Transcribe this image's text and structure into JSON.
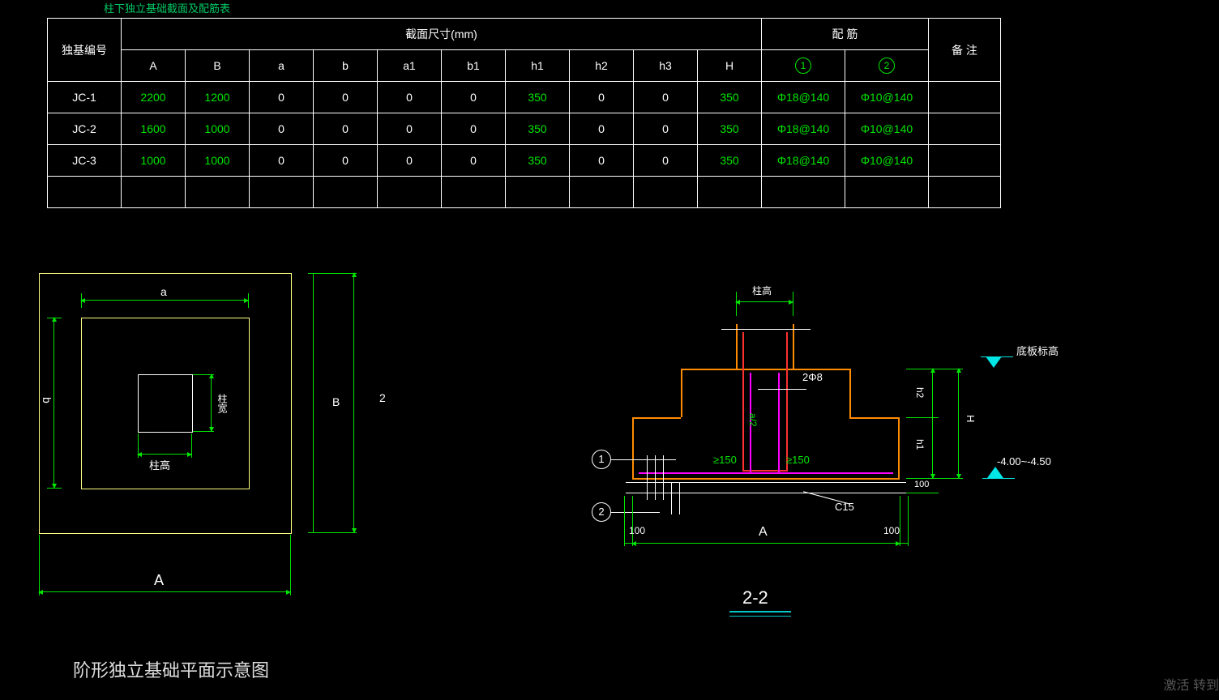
{
  "topTitle": "柱下独立基础截面及配筋表",
  "table": {
    "hId": "独基编号",
    "hSec": "截面尺寸(mm)",
    "hRebar": "配  筋",
    "hNote": "备  注",
    "cols": [
      "A",
      "B",
      "a",
      "b",
      "a1",
      "b1",
      "h1",
      "h2",
      "h3",
      "H"
    ],
    "rebars": [
      "①",
      "②"
    ],
    "rows": [
      {
        "id": "JC-1",
        "v": [
          "2200",
          "1200",
          "0",
          "0",
          "0",
          "0",
          "350",
          "0",
          "0",
          "350"
        ],
        "r": [
          "Φ18@140",
          "Φ10@140"
        ]
      },
      {
        "id": "JC-2",
        "v": [
          "1600",
          "1000",
          "0",
          "0",
          "0",
          "0",
          "350",
          "0",
          "0",
          "350"
        ],
        "r": [
          "Φ18@140",
          "Φ10@140"
        ]
      },
      {
        "id": "JC-3",
        "v": [
          "1000",
          "1000",
          "0",
          "0",
          "0",
          "0",
          "350",
          "0",
          "0",
          "350"
        ],
        "r": [
          "Φ18@140",
          "Φ10@140"
        ]
      }
    ]
  },
  "plan": {
    "a": "a",
    "b": "b",
    "A": "A",
    "B": "B",
    "zhugao": "柱高",
    "zhukuan": "柱宽",
    "twoArrow": "2"
  },
  "section": {
    "title": "2-2",
    "zhugao": "柱高",
    "didian": "底板标高",
    "elev": "-4.00~-4.50",
    "bar": "2Φ8",
    "s150a": "≥150",
    "s150b": "≥150",
    "c15": "C15",
    "A": "A",
    "H": "H",
    "h1": "h1",
    "h2": "h2",
    "d100a": "100",
    "d100b": "100",
    "d100c": "100",
    "a_over": "a/2",
    "circle1": "1",
    "circle2": "2"
  },
  "bottomTitle": "阶形独立基础平面示意图",
  "watermark": "激活\n转到"
}
